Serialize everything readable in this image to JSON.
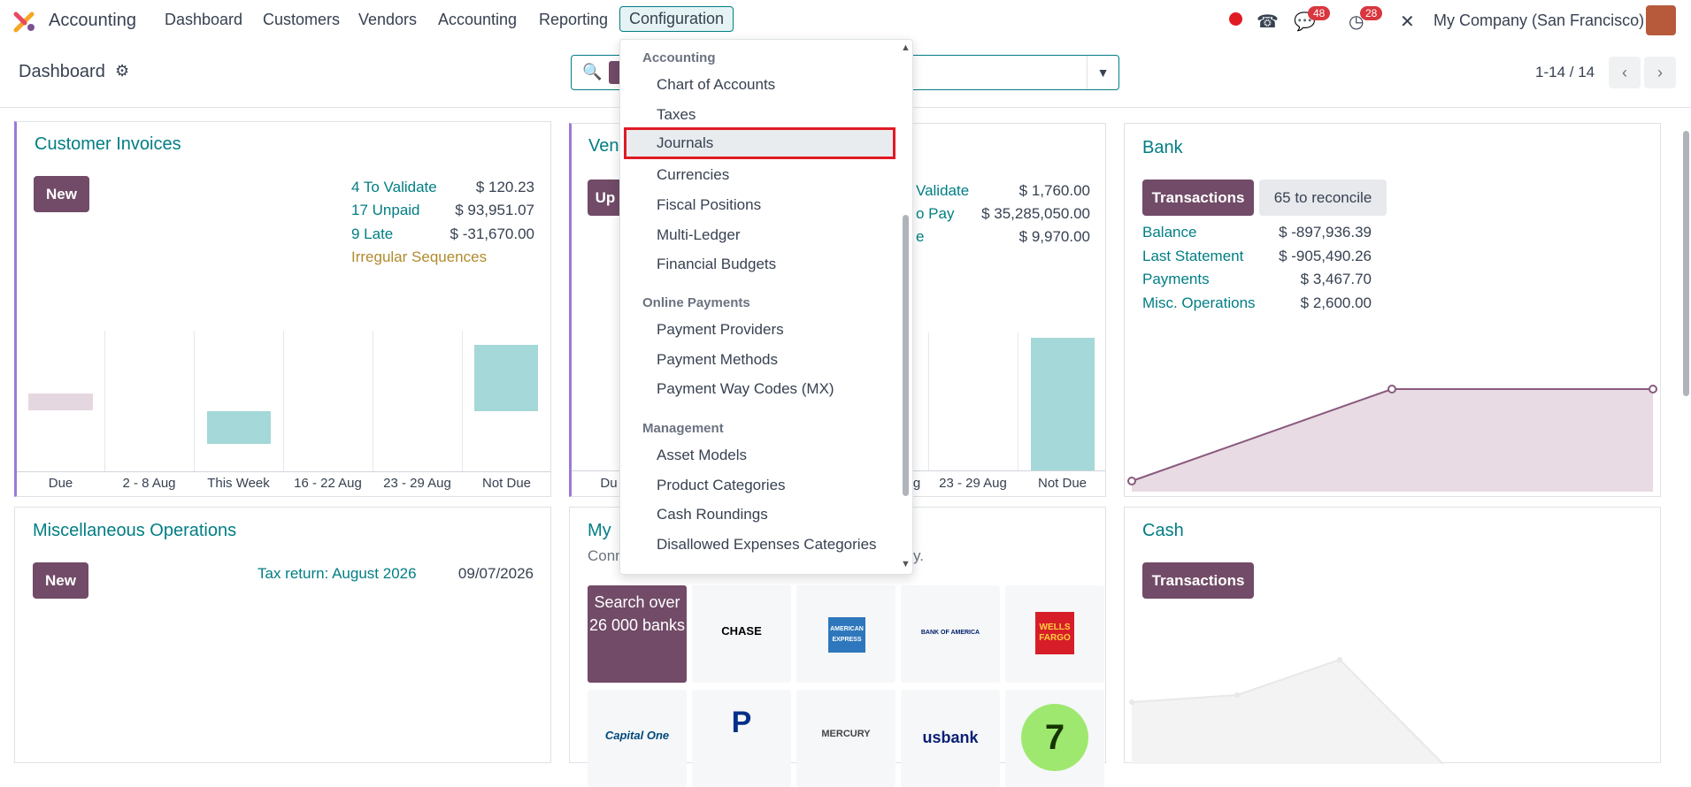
{
  "nav": {
    "app_name": "Accounting",
    "items": [
      "Dashboard",
      "Customers",
      "Vendors",
      "Accounting",
      "Reporting",
      "Configuration"
    ],
    "badge_messages": "48",
    "badge_activities": "28",
    "company": "My Company (San Francisco)"
  },
  "control_panel": {
    "breadcrumb": "Dashboard",
    "pager": "1-14 / 14"
  },
  "dropdown": {
    "sections": [
      {
        "heading": "Accounting",
        "items": [
          "Chart of Accounts",
          "Taxes",
          "Journals",
          "Currencies",
          "Fiscal Positions",
          "Multi-Ledger",
          "Financial Budgets"
        ]
      },
      {
        "heading": "Online Payments",
        "items": [
          "Payment Providers",
          "Payment Methods",
          "Payment Way Codes (MX)"
        ]
      },
      {
        "heading": "Management",
        "items": [
          "Asset Models",
          "Product Categories",
          "Cash Roundings",
          "Disallowed Expenses Categories"
        ]
      }
    ]
  },
  "customer_invoices": {
    "title": "Customer Invoices",
    "new_label": "New",
    "rows": [
      {
        "label": "4 To Validate",
        "amount": "$ 120.23"
      },
      {
        "label": "17 Unpaid",
        "amount": "$ 93,951.07"
      },
      {
        "label": "9 Late",
        "amount": "$ -31,670.00"
      }
    ],
    "warning": "Irregular Sequences",
    "x_labels": [
      "Due",
      "2 - 8 Aug",
      "This Week",
      "16 - 22 Aug",
      "23 - 29 Aug",
      "Not Due"
    ]
  },
  "vendor_bills": {
    "title_partial": "Ven",
    "button_partial": "Up",
    "rows": [
      {
        "label": "Validate",
        "amount": "$ 1,760.00"
      },
      {
        "label": "o Pay",
        "amount": "$ 35,285,050.00"
      },
      {
        "label": "e",
        "amount": "$ 9,970.00"
      }
    ],
    "x_labels": [
      "Du",
      "g",
      "23 - 29 Aug",
      "Not Due"
    ]
  },
  "bank": {
    "title": "Bank",
    "transactions_label": "Transactions",
    "reconcile_label": "65 to reconcile",
    "rows": [
      {
        "label": "Balance",
        "amount": "$ -897,936.39"
      },
      {
        "label": "Last Statement",
        "amount": "$ -905,490.26"
      },
      {
        "label": "Payments",
        "amount": "$ 3,467.70"
      },
      {
        "label": "Misc. Operations",
        "amount": "$ 2,600.00"
      }
    ]
  },
  "misc": {
    "title": "Miscellaneous Operations",
    "new_label": "New",
    "link": "Tax return: August 2026",
    "date": "09/07/2026"
  },
  "banks_card": {
    "title_partial": "My",
    "subtitle_left": "Conn",
    "subtitle_right": "y.",
    "search_tile": "Search over 26 000 banks",
    "logos": [
      "CHASE",
      "AMERICAN EXPRESS",
      "BANK OF AMERICA",
      "WELLS FARGO",
      "Capital One",
      "PayPal",
      "MERCURY",
      "usbank",
      ""
    ]
  },
  "cash": {
    "title": "Cash",
    "transactions_label": "Transactions"
  },
  "colors": {
    "brand": "#714b67",
    "link": "#017e84",
    "bar_teal": "#a5d8d8",
    "bar_pink": "#e5d7df",
    "line": "#8a5a7e"
  }
}
